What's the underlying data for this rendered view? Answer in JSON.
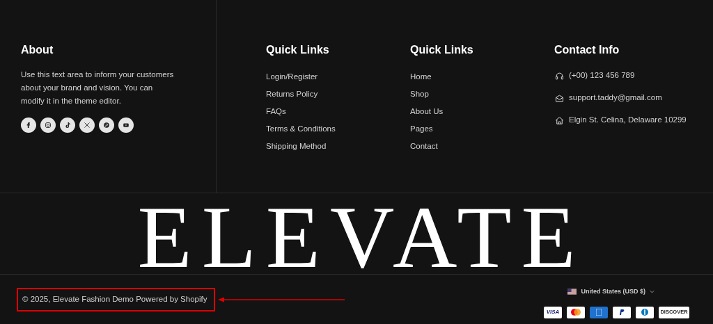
{
  "about": {
    "heading": "About",
    "text": "Use this text area to inform your customers about your brand and vision. You can modify it in the theme editor.",
    "socials": [
      {
        "kind": "facebook"
      },
      {
        "kind": "instagram"
      },
      {
        "kind": "tiktok"
      },
      {
        "kind": "x"
      },
      {
        "kind": "pinterest"
      },
      {
        "kind": "youtube"
      }
    ]
  },
  "link_columns": [
    {
      "heading": "Quick Links",
      "links": [
        "Login/Register",
        "Returns Policy",
        "FAQs",
        "Terms & Conditions",
        "Shipping Method"
      ]
    },
    {
      "heading": "Quick Links",
      "links": [
        "Home",
        "Shop",
        "About Us",
        "Pages",
        "Contact"
      ]
    }
  ],
  "contact": {
    "heading": "Contact Info",
    "items": [
      {
        "kind": "phone",
        "text": "(+00) 123 456 789"
      },
      {
        "kind": "email",
        "text": "support.taddy@gmail.com"
      },
      {
        "kind": "address",
        "text": "Elgin St. Celina, Delaware 10299"
      }
    ]
  },
  "brand": "ELEVATE",
  "copyright": "© 2025, Elevate Fashion Demo Powered by Shopify",
  "currency": "United States (USD $)",
  "payments": [
    {
      "kind": "visa",
      "label": "VISA"
    },
    {
      "kind": "mastercard"
    },
    {
      "kind": "amex"
    },
    {
      "kind": "paypal"
    },
    {
      "kind": "diners"
    },
    {
      "kind": "discover",
      "label": "DISCOVER"
    }
  ]
}
